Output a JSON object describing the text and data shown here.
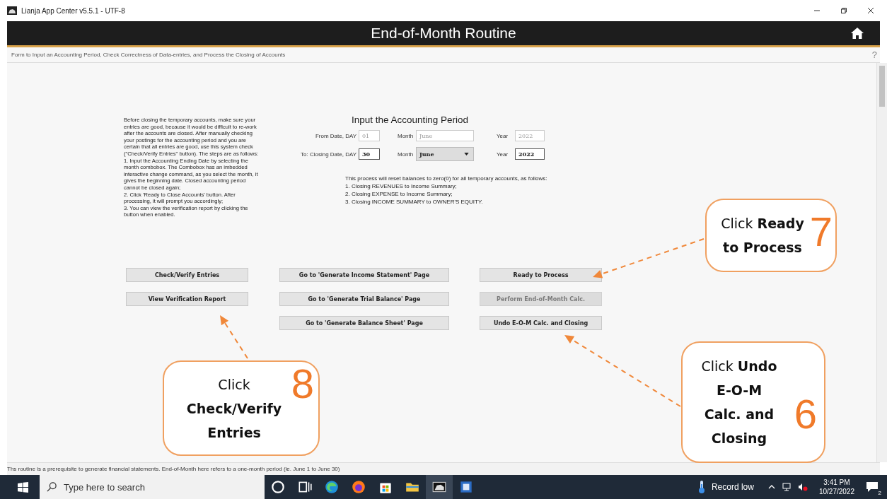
{
  "window": {
    "title": "Lianja App Center v5.5.1 - UTF-8"
  },
  "header": {
    "title": "End-of-Month Routine"
  },
  "subtitle": {
    "text": "Form to Input an Accounting Period, Check Correctness of Data-entries, and Process the Closing of Accounts",
    "help": "?"
  },
  "instructions": {
    "intro": "Before closing the temporary accounts, make sure your entries are good, because it would be difficult to re-work after the accounts are closed. After manually checking your postings for the accounting period and you are certain that all entries are good, use this system check (\"Check/Verify Entries\" button). The steps are as follows:",
    "steps": [
      "1. Input the Accounting Ending Date by selecting the month combobox. The Combobox has an imbedded interactive change command, as you select the month, it gives the beginning date. Closed accounting period cannot be closed again;",
      "2. Click 'Ready to Close Accounts' button. After processing, it will prompt you accordingly;",
      "3. You can view the verification report by clicking the button when enabled."
    ]
  },
  "period": {
    "heading": "Input the Accounting Period",
    "rows": [
      {
        "day_label": "From Date, DAY",
        "day": "01",
        "month_label": "Month",
        "month": {
          "kind": "text",
          "value": "June"
        },
        "year_label": "Year",
        "year": "2022",
        "disabled": true
      },
      {
        "day_label": "To: Closing Date, DAY",
        "day": "30",
        "month_label": "Month",
        "month": {
          "kind": "combo",
          "value": "June"
        },
        "year_label": "Year",
        "year": "2022",
        "disabled": false
      }
    ]
  },
  "notice": {
    "intro": "This process will reset balances to zero(0) for all temporary accounts, as follows:",
    "steps": [
      "1. Closing REVENUES to Income Summary;",
      "2. Closing EXPENSE to Income Summary;",
      "3. Closing INCOME SUMMARY to OWNER'S EQUITY."
    ]
  },
  "buttons": [
    [
      {
        "label": "Check/Verify Entries",
        "disabled": false
      },
      {
        "label": "View Verification Report",
        "disabled": false
      }
    ],
    [
      {
        "label": "Go to 'Generate Income Statement' Page",
        "disabled": false
      },
      {
        "label": "Go to 'Generate Trial Balance' Page",
        "disabled": false
      },
      {
        "label": "Go to 'Generate Balance Sheet' Page",
        "disabled": false
      }
    ],
    [
      {
        "label": "Ready to Process",
        "disabled": false
      },
      {
        "label": "Perform End-of-Month Calc.",
        "disabled": true
      },
      {
        "label": "Undo E-O-M Calc. and Closing",
        "disabled": false
      }
    ]
  ],
  "callouts": [
    {
      "text": "Click **Ready to Process**",
      "number": "7"
    },
    {
      "text": "Click **Check/Verify Entries**",
      "number": "8"
    },
    {
      "text": "Click **Undo E-O-M Calc. and Closing**",
      "number": "6"
    }
  ],
  "status_bar": "Ths routine is a prerequisite to generate financial statements. End-of-Month here refers to a one-month period (ie. June 1 to June 30)",
  "taskbar": {
    "search_placeholder": "Type here to search",
    "weather": "Record low",
    "time": "3:41 PM",
    "date": "10/27/2022",
    "notifications": "2"
  }
}
